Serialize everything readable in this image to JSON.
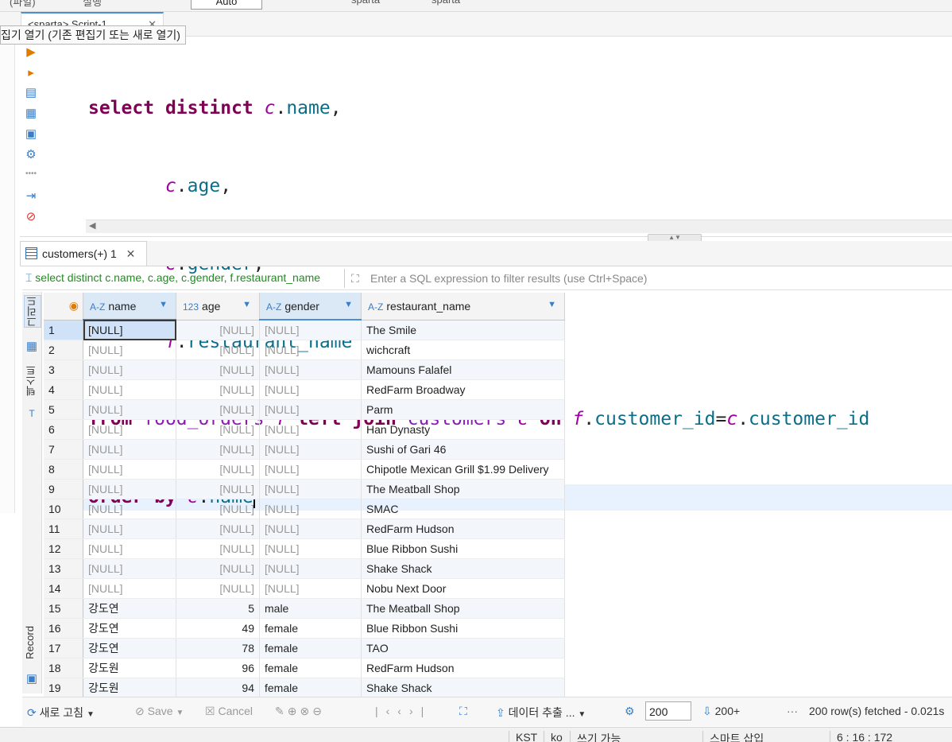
{
  "top_toolbar": {
    "items": [
      "(파일)",
      "실행",
      "Auto",
      "sparta",
      "sparta"
    ],
    "auto_value": "Auto"
  },
  "editor_tab": {
    "label": "<sparta> Script-1",
    "close": "✕"
  },
  "tooltip": {
    "text": "집기 열기 (기존 편집기 또는 새로 열기)"
  },
  "sql": {
    "kw_select": "select",
    "kw_distinct": "distinct",
    "alias_c": "c",
    "alias_f": "f",
    "col_name": "name",
    "col_age": "age",
    "col_gender": "gender",
    "col_restaurant_name": "restaurant_name",
    "kw_from": "from",
    "tbl_food_orders": "food_orders",
    "kw_left": "left",
    "kw_join": "join",
    "tbl_customers": "customers",
    "kw_on": "on",
    "col_customer_id": "customer_id",
    "kw_order": "order",
    "kw_by": "by"
  },
  "results": {
    "tab_label": "customers(+) 1",
    "tab_close": "✕",
    "sql_preview": "select distinct c.name, c.age, c.gender, f.restaurant_name",
    "filter_placeholder": "Enter a SQL expression to filter results (use Ctrl+Space)",
    "side_tabs": [
      "그리드",
      "텍스트",
      "Record"
    ],
    "columns": [
      {
        "type": "A-Z",
        "name": "name"
      },
      {
        "type": "123",
        "name": "age"
      },
      {
        "type": "A-Z",
        "name": "gender"
      },
      {
        "type": "A-Z",
        "name": "restaurant_name"
      }
    ],
    "rows": [
      {
        "n": "1",
        "name": "[NULL]",
        "age": "[NULL]",
        "gender": "[NULL]",
        "restaurant": "The Smile"
      },
      {
        "n": "2",
        "name": "[NULL]",
        "age": "[NULL]",
        "gender": "[NULL]",
        "restaurant": "wichcraft"
      },
      {
        "n": "3",
        "name": "[NULL]",
        "age": "[NULL]",
        "gender": "[NULL]",
        "restaurant": "Mamouns Falafel"
      },
      {
        "n": "4",
        "name": "[NULL]",
        "age": "[NULL]",
        "gender": "[NULL]",
        "restaurant": "RedFarm Broadway"
      },
      {
        "n": "5",
        "name": "[NULL]",
        "age": "[NULL]",
        "gender": "[NULL]",
        "restaurant": "Parm"
      },
      {
        "n": "6",
        "name": "[NULL]",
        "age": "[NULL]",
        "gender": "[NULL]",
        "restaurant": "Han Dynasty"
      },
      {
        "n": "7",
        "name": "[NULL]",
        "age": "[NULL]",
        "gender": "[NULL]",
        "restaurant": "Sushi of Gari 46"
      },
      {
        "n": "8",
        "name": "[NULL]",
        "age": "[NULL]",
        "gender": "[NULL]",
        "restaurant": "Chipotle Mexican Grill $1.99 Delivery"
      },
      {
        "n": "9",
        "name": "[NULL]",
        "age": "[NULL]",
        "gender": "[NULL]",
        "restaurant": "The Meatball Shop"
      },
      {
        "n": "10",
        "name": "[NULL]",
        "age": "[NULL]",
        "gender": "[NULL]",
        "restaurant": "SMAC"
      },
      {
        "n": "11",
        "name": "[NULL]",
        "age": "[NULL]",
        "gender": "[NULL]",
        "restaurant": "RedFarm Hudson"
      },
      {
        "n": "12",
        "name": "[NULL]",
        "age": "[NULL]",
        "gender": "[NULL]",
        "restaurant": "Blue Ribbon Sushi"
      },
      {
        "n": "13",
        "name": "[NULL]",
        "age": "[NULL]",
        "gender": "[NULL]",
        "restaurant": "Shake Shack"
      },
      {
        "n": "14",
        "name": "[NULL]",
        "age": "[NULL]",
        "gender": "[NULL]",
        "restaurant": "Nobu Next Door"
      },
      {
        "n": "15",
        "name": "강도연",
        "age": "5",
        "gender": "male",
        "restaurant": "The Meatball Shop"
      },
      {
        "n": "16",
        "name": "강도연",
        "age": "49",
        "gender": "female",
        "restaurant": "Blue Ribbon Sushi"
      },
      {
        "n": "17",
        "name": "강도연",
        "age": "78",
        "gender": "female",
        "restaurant": "TAO"
      },
      {
        "n": "18",
        "name": "강도원",
        "age": "96",
        "gender": "female",
        "restaurant": "RedFarm Hudson"
      },
      {
        "n": "19",
        "name": "강도원",
        "age": "94",
        "gender": "female",
        "restaurant": "Shake Shack"
      }
    ]
  },
  "bottom_toolbar": {
    "refresh": "새로 고침",
    "save": "Save",
    "cancel": "Cancel",
    "export": "데이터 추출 ...",
    "fetch_size": "200",
    "fetch_more": "200+",
    "status": "200 row(s) fetched - 0.021s"
  },
  "status_bar": {
    "timezone": "KST",
    "locale": "ko",
    "mode": "쓰기 가능",
    "insert": "스마트 삽입",
    "position": "6 : 16 : 172"
  }
}
